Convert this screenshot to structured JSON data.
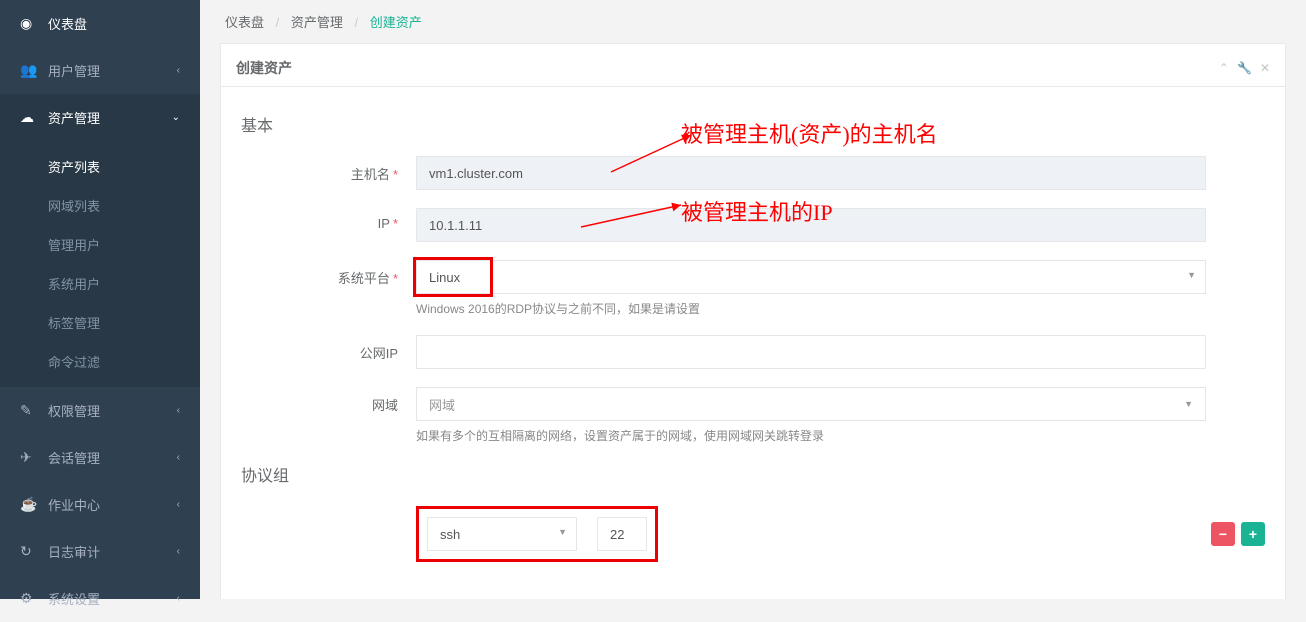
{
  "sidebar": {
    "items": [
      {
        "icon": "dashboard",
        "label": "仪表盘",
        "expand": ""
      },
      {
        "icon": "users",
        "label": "用户管理",
        "expand": "‹"
      },
      {
        "icon": "cloud",
        "label": "资产管理",
        "expand": "⌄",
        "active": true
      },
      {
        "icon": "edit",
        "label": "权限管理",
        "expand": "‹"
      },
      {
        "icon": "rocket",
        "label": "会话管理",
        "expand": "‹"
      },
      {
        "icon": "coffee",
        "label": "作业中心",
        "expand": "‹"
      },
      {
        "icon": "history",
        "label": "日志审计",
        "expand": "‹"
      },
      {
        "icon": "cogs",
        "label": "系统设置",
        "expand": "‹"
      }
    ],
    "sub": [
      {
        "label": "资产列表",
        "active": true
      },
      {
        "label": "网域列表"
      },
      {
        "label": "管理用户"
      },
      {
        "label": "系统用户"
      },
      {
        "label": "标签管理"
      },
      {
        "label": "命令过滤"
      }
    ]
  },
  "breadcrumb": {
    "a": "仪表盘",
    "b": "资产管理",
    "c": "创建资产"
  },
  "panel": {
    "title": "创建资产"
  },
  "section": {
    "basic": "基本",
    "protocol": "协议组"
  },
  "labels": {
    "hostname": "主机名",
    "ip": "IP",
    "platform": "系统平台",
    "publicip": "公网IP",
    "domain": "网域"
  },
  "values": {
    "hostname": "vm1.cluster.com",
    "ip": "10.1.1.11",
    "platform": "Linux",
    "publicip": "",
    "domain_placeholder": "网域",
    "proto_name": "ssh",
    "proto_port": "22"
  },
  "help": {
    "platform": "Windows 2016的RDP协议与之前不同，如果是请设置",
    "domain": "如果有多个的互相隔离的网络，设置资产属于的网域，使用网域网关跳转登录"
  },
  "annotations": {
    "hostname": "被管理主机(资产)的主机名",
    "ip": "被管理主机的IP"
  },
  "icons": {
    "dashboard": "◉",
    "users": "👥",
    "cloud": "☁",
    "edit": "✎",
    "rocket": "✈",
    "coffee": "☕",
    "history": "↻",
    "cogs": "⚙"
  }
}
